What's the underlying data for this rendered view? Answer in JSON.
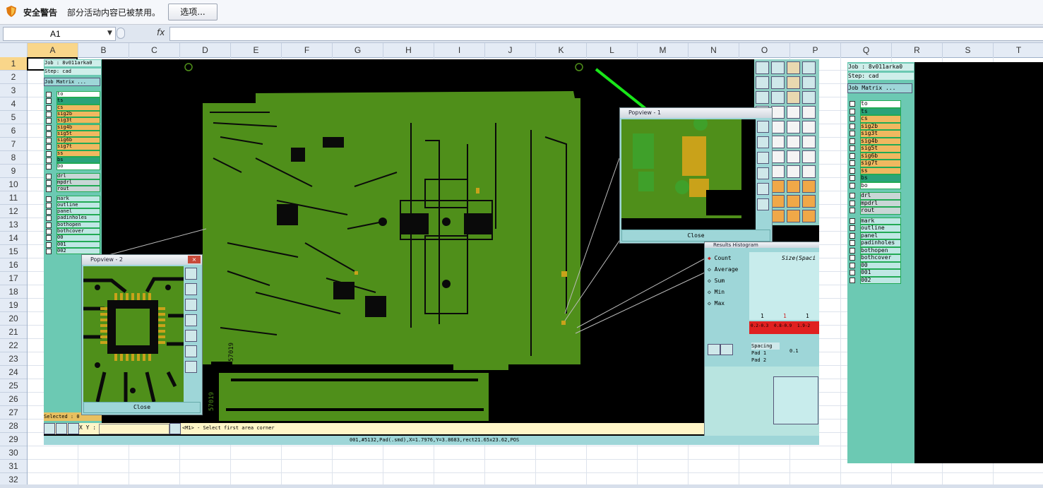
{
  "security_bar": {
    "title": "安全警告",
    "message": "部分活动内容已被禁用。",
    "options_button": "选项..."
  },
  "formula_bar": {
    "name_box": "A1",
    "fx_label": "fx",
    "formula": ""
  },
  "columns": [
    "A",
    "B",
    "C",
    "D",
    "E",
    "F",
    "G",
    "H",
    "I",
    "J",
    "K",
    "L",
    "M",
    "N",
    "O",
    "P",
    "Q",
    "R",
    "S",
    "T"
  ],
  "rows": [
    "1",
    "2",
    "3",
    "4",
    "5",
    "6",
    "7",
    "8",
    "9",
    "10",
    "11",
    "12",
    "13",
    "14",
    "15",
    "16",
    "17",
    "18",
    "19",
    "20",
    "21",
    "22",
    "23",
    "24",
    "25",
    "26",
    "27",
    "28",
    "29",
    "30",
    "31",
    "32"
  ],
  "cad": {
    "job_label": "Job : 8v011arka0",
    "step_label": "Step: cad",
    "matrix_button": "Job Matrix ...",
    "layers_signal": [
      "to",
      "ts",
      "cs",
      "sig2b",
      "sig3t",
      "sig4b",
      "sig5t",
      "sig6b",
      "sig7t",
      "ss",
      "bs",
      "bo"
    ],
    "layers_drill": [
      "drl",
      "mpdrl",
      "rout"
    ],
    "layers_misc": [
      "mark",
      "outline",
      "panel",
      "padinholes",
      "bothopen",
      "bothcover",
      "00",
      "001",
      "002"
    ],
    "selected_label": "Selected : 0",
    "xy_label": "X Y :",
    "prompt": "<M1> - Select first area corner",
    "status_line": "001,#5132,Pad(.smd),X=1.7976,Y=3.8683,rect21.65x23.62,POS",
    "popview1_title": "Popview - 1",
    "popview2_title": "Popview - 2",
    "close_label": "Close",
    "histogram_title": "Results Histogram",
    "histogram_options": [
      "Count",
      "Average",
      "Sum",
      "Min",
      "Max"
    ],
    "histogram_header": "Size(Spaci",
    "histogram_counts": [
      "1",
      "1",
      "1"
    ],
    "histogram_bins": [
      "0.2-0.3",
      "0.8-0.9",
      "1.9-2"
    ],
    "spacing_label": "Spacing",
    "pad1_label": "Pad 1",
    "pad2_label": "Pad 2",
    "spacing_value": "0.1",
    "board_text": "57019"
  },
  "cad_right": {
    "job_label": "Job : 8v011arka0",
    "step_label": "Step: cad",
    "matrix_button": "Job Matrix ...",
    "layers_signal": [
      "to",
      "ts",
      "cs",
      "sig2b",
      "sig3t",
      "sig4b",
      "sig5t",
      "sig6b",
      "sig7t",
      "ss",
      "bs",
      "bo"
    ],
    "layers_drill": [
      "drl",
      "mpdrl",
      "rout"
    ],
    "layers_misc": [
      "mark",
      "outline",
      "panel",
      "padinholes",
      "bothopen",
      "bothcover",
      "00",
      "001",
      "002"
    ]
  },
  "colors": {
    "board_green": "#4f8f1a",
    "copper": "#c9a21a",
    "panel_teal": "#6cc9b3",
    "arrow_green": "#19e619",
    "highlight_red": "#e02020"
  }
}
